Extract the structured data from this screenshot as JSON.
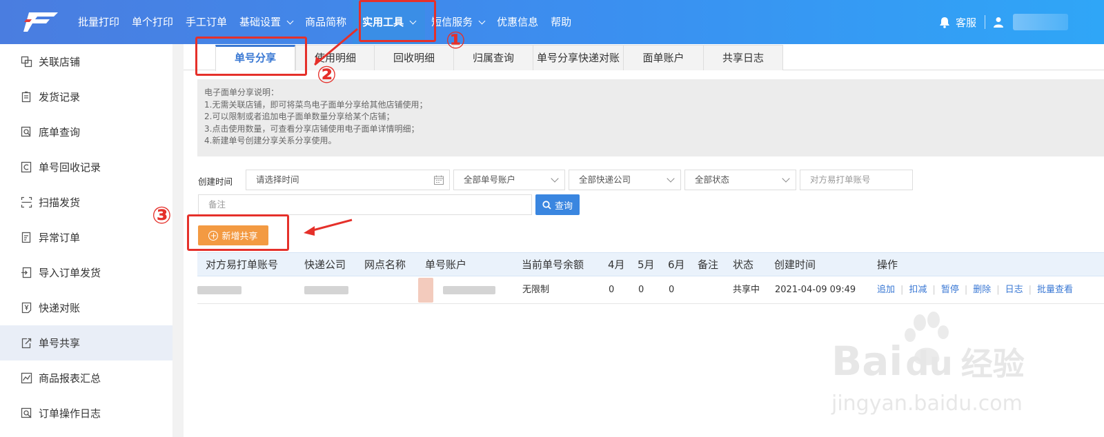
{
  "topbar": {
    "nav": [
      {
        "label": "批量打印"
      },
      {
        "label": "单个打印"
      },
      {
        "label": "手工订单"
      },
      {
        "label": "基础设置",
        "dropdown": true
      },
      {
        "label": "商品简称"
      },
      {
        "label": "实用工具",
        "dropdown": true,
        "active": true
      },
      {
        "label": "短信服务",
        "dropdown": true
      },
      {
        "label": "优惠信息"
      },
      {
        "label": "帮助"
      }
    ],
    "service_label": "客服",
    "icons": {
      "service": "bell-icon",
      "user": "user-icon"
    }
  },
  "sidebar": {
    "items": [
      {
        "label": "关联店铺",
        "icon": "link-store-icon"
      },
      {
        "label": "发货记录",
        "icon": "clipboard-icon"
      },
      {
        "label": "底单查询",
        "icon": "receipt-search-icon"
      },
      {
        "label": "单号回收记录",
        "icon": "recycle-doc-icon"
      },
      {
        "label": "扫描发货",
        "icon": "scan-icon"
      },
      {
        "label": "异常订单",
        "icon": "exception-doc-icon"
      },
      {
        "label": "导入订单发货",
        "icon": "import-icon"
      },
      {
        "label": "快递对账",
        "icon": "yen-doc-icon"
      },
      {
        "label": "单号共享",
        "icon": "share-doc-icon",
        "active": true
      },
      {
        "label": "商品报表汇总",
        "icon": "chart-icon"
      },
      {
        "label": "订单操作日志",
        "icon": "log-search-icon"
      }
    ]
  },
  "tabs": [
    {
      "label": "单号分享",
      "active": true
    },
    {
      "label": "使用明细"
    },
    {
      "label": "回收明细"
    },
    {
      "label": "归属查询"
    },
    {
      "label": "单号分享快递对账"
    },
    {
      "label": "面单账户"
    },
    {
      "label": "共享日志"
    }
  ],
  "notice": {
    "title": "电子面单分享说明：",
    "lines": [
      "1.无需关联店铺，即可将菜鸟电子面单分享给其他店铺使用；",
      "2.可以限制或者追加电子面单数量分享给某个店铺；",
      "3.点击使用数量，可查看分享店铺使用电子面单详情明细；",
      "4.新建单号创建分享关系分享使用。"
    ]
  },
  "filters": {
    "created_time_label": "创建时间",
    "time_placeholder": "请选择时间",
    "account_select": "全部单号账户",
    "courier_select": "全部快递公司",
    "status_select": "全部状态",
    "peer_account_placeholder": "对方易打单账号",
    "remark_placeholder": "备注",
    "query_button": "查询"
  },
  "add_share_button": "新增共享",
  "table": {
    "columns": [
      "对方易打单账号",
      "快递公司",
      "网点名称",
      "单号账户",
      "当前单号余额",
      "4月",
      "5月",
      "6月",
      "备注",
      "状态",
      "创建时间",
      "操作"
    ],
    "rows": [
      {
        "balance": "无限制",
        "apr": "0",
        "may": "0",
        "jun": "0",
        "status": "共享中",
        "created": "2021-04-09 09:49",
        "actions": [
          "追加",
          "扣减",
          "暂停",
          "删除",
          "日志",
          "批量查看"
        ]
      }
    ]
  },
  "annotations": {
    "step1": "①",
    "step2": "②",
    "step3": "③",
    "color": "#e5302a"
  },
  "watermark": {
    "brand": "Bai",
    "brand2": "du",
    "cn": "经验",
    "url": "jingyan.baidu.com"
  }
}
